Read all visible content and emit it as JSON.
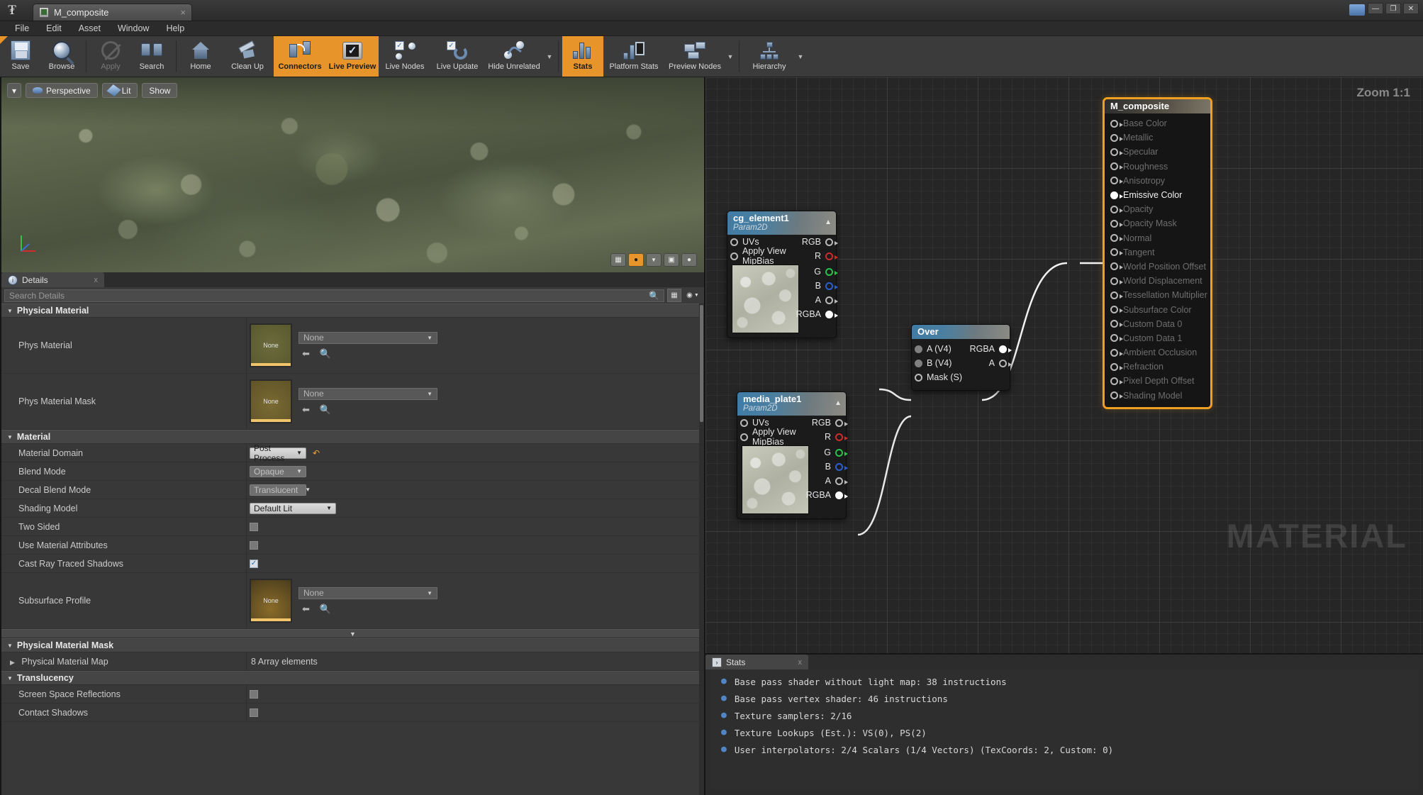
{
  "window": {
    "tab_title": "M_composite",
    "tab_close": "×",
    "minimize": "—",
    "maximize": "❐",
    "close": "✕"
  },
  "menu": [
    "File",
    "Edit",
    "Asset",
    "Window",
    "Help"
  ],
  "toolbar": [
    {
      "label": "Save",
      "icon": "save-icon",
      "state": "normal"
    },
    {
      "label": "Browse",
      "icon": "browse-icon",
      "state": "normal"
    },
    {
      "label": "Apply",
      "icon": "apply-icon",
      "state": "disabled"
    },
    {
      "label": "Search",
      "icon": "search-icon",
      "state": "normal"
    },
    {
      "label": "Home",
      "icon": "home-icon",
      "state": "normal"
    },
    {
      "label": "Clean Up",
      "icon": "cleanup-icon",
      "state": "normal"
    },
    {
      "label": "Connectors",
      "icon": "connectors-icon",
      "state": "active"
    },
    {
      "label": "Live Preview",
      "icon": "live-preview-icon",
      "state": "active"
    },
    {
      "label": "Live Nodes",
      "icon": "live-nodes-icon",
      "state": "normal"
    },
    {
      "label": "Live Update",
      "icon": "live-update-icon",
      "state": "normal"
    },
    {
      "label": "Hide Unrelated",
      "icon": "hide-unrelated-icon",
      "state": "normal"
    },
    {
      "label": "Stats",
      "icon": "stats-icon",
      "state": "active"
    },
    {
      "label": "Platform Stats",
      "icon": "platform-stats-icon",
      "state": "normal"
    },
    {
      "label": "Preview Nodes",
      "icon": "preview-nodes-icon",
      "state": "normal"
    },
    {
      "label": "Hierarchy",
      "icon": "hierarchy-icon",
      "state": "normal"
    }
  ],
  "viewport": {
    "view_menu": "▾",
    "perspective": "Perspective",
    "lit": "Lit",
    "show": "Show"
  },
  "details": {
    "tab_label": "Details",
    "tab_close": "x",
    "search_placeholder": "Search Details",
    "sections": [
      {
        "title": "Physical Material",
        "rows": [
          {
            "name": "Phys Material",
            "type": "asset",
            "value": "None",
            "thumb": "None"
          },
          {
            "name": "Phys Material Mask",
            "type": "asset",
            "value": "None",
            "thumb": "None"
          }
        ]
      },
      {
        "title": "Material",
        "rows": [
          {
            "name": "Material Domain",
            "type": "combo",
            "value": "Post Process",
            "enabled": true,
            "reset": true
          },
          {
            "name": "Blend Mode",
            "type": "combo",
            "value": "Opaque",
            "enabled": false
          },
          {
            "name": "Decal Blend Mode",
            "type": "combo",
            "value": "Translucent",
            "enabled": false
          },
          {
            "name": "Shading Model",
            "type": "combo",
            "value": "Default Lit",
            "enabled": true
          },
          {
            "name": "Two Sided",
            "type": "checkbox",
            "checked": false
          },
          {
            "name": "Use Material Attributes",
            "type": "checkbox",
            "checked": false
          },
          {
            "name": "Cast Ray Traced Shadows",
            "type": "checkbox",
            "checked": true
          },
          {
            "name": "Subsurface Profile",
            "type": "asset",
            "value": "None",
            "thumb": "None"
          }
        ]
      },
      {
        "title": "Physical Material Mask",
        "rows": [
          {
            "name": "Physical Material Map",
            "type": "text",
            "value": "8 Array elements",
            "expandable": true
          }
        ]
      },
      {
        "title": "Translucency",
        "rows": [
          {
            "name": "Screen Space Reflections",
            "type": "checkbox",
            "checked": false
          },
          {
            "name": "Contact Shadows",
            "type": "checkbox",
            "checked": false
          }
        ]
      }
    ]
  },
  "graph": {
    "zoom_label": "Zoom 1:1",
    "watermark": "MATERIAL",
    "nodes": [
      {
        "id": "cg_element1",
        "title": "cg_element1",
        "subtitle": "Param2D",
        "collapse": "▲",
        "inputs": [
          "UVs",
          "Apply View MipBias"
        ],
        "outputs": [
          {
            "label": "RGB",
            "color": "white"
          },
          {
            "label": "R",
            "color": "red"
          },
          {
            "label": "G",
            "color": "green"
          },
          {
            "label": "B",
            "color": "blue"
          },
          {
            "label": "A",
            "color": "white"
          },
          {
            "label": "RGBA",
            "color": "white",
            "connected": true
          }
        ]
      },
      {
        "id": "media_plate1",
        "title": "media_plate1",
        "subtitle": "Param2D",
        "collapse": "▲",
        "inputs": [
          "UVs",
          "Apply View MipBias"
        ],
        "outputs": [
          {
            "label": "RGB",
            "color": "white"
          },
          {
            "label": "R",
            "color": "red"
          },
          {
            "label": "G",
            "color": "green"
          },
          {
            "label": "B",
            "color": "blue"
          },
          {
            "label": "A",
            "color": "white"
          },
          {
            "label": "RGBA",
            "color": "white",
            "connected": true
          }
        ]
      },
      {
        "id": "over",
        "title": "Over",
        "subtitle": "",
        "inputs": [
          "A (V4)",
          "B (V4)",
          "Mask (S)"
        ],
        "outputs": [
          {
            "label": "RGBA",
            "color": "white",
            "connected": true
          },
          {
            "label": "A",
            "color": "white"
          }
        ]
      }
    ],
    "material_node": {
      "title": "M_composite",
      "pins": [
        {
          "label": "Base Color",
          "connected": false
        },
        {
          "label": "Metallic",
          "connected": false
        },
        {
          "label": "Specular",
          "connected": false
        },
        {
          "label": "Roughness",
          "connected": false
        },
        {
          "label": "Anisotropy",
          "connected": false
        },
        {
          "label": "Emissive Color",
          "connected": true
        },
        {
          "label": "Opacity",
          "connected": false
        },
        {
          "label": "Opacity Mask",
          "connected": false
        },
        {
          "label": "Normal",
          "connected": false
        },
        {
          "label": "Tangent",
          "connected": false
        },
        {
          "label": "World Position Offset",
          "connected": false
        },
        {
          "label": "World Displacement",
          "connected": false
        },
        {
          "label": "Tessellation Multiplier",
          "connected": false
        },
        {
          "label": "Subsurface Color",
          "connected": false
        },
        {
          "label": "Custom Data 0",
          "connected": false
        },
        {
          "label": "Custom Data 1",
          "connected": false
        },
        {
          "label": "Ambient Occlusion",
          "connected": false
        },
        {
          "label": "Refraction",
          "connected": false
        },
        {
          "label": "Pixel Depth Offset",
          "connected": false
        },
        {
          "label": "Shading Model",
          "connected": false
        }
      ]
    }
  },
  "stats": {
    "tab_label": "Stats",
    "tab_close": "x",
    "lines": [
      "Base pass shader without light map: 38 instructions",
      "Base pass vertex shader: 46 instructions",
      "Texture samplers: 2/16",
      "Texture Lookups (Est.): VS(0), PS(2)",
      "User interpolators: 2/4 Scalars (1/4 Vectors) (TexCoords: 2, Custom: 0)"
    ]
  },
  "colors": {
    "accent": "#e7952a",
    "node_selected": "#f0a020",
    "panel_bg": "#383838"
  }
}
